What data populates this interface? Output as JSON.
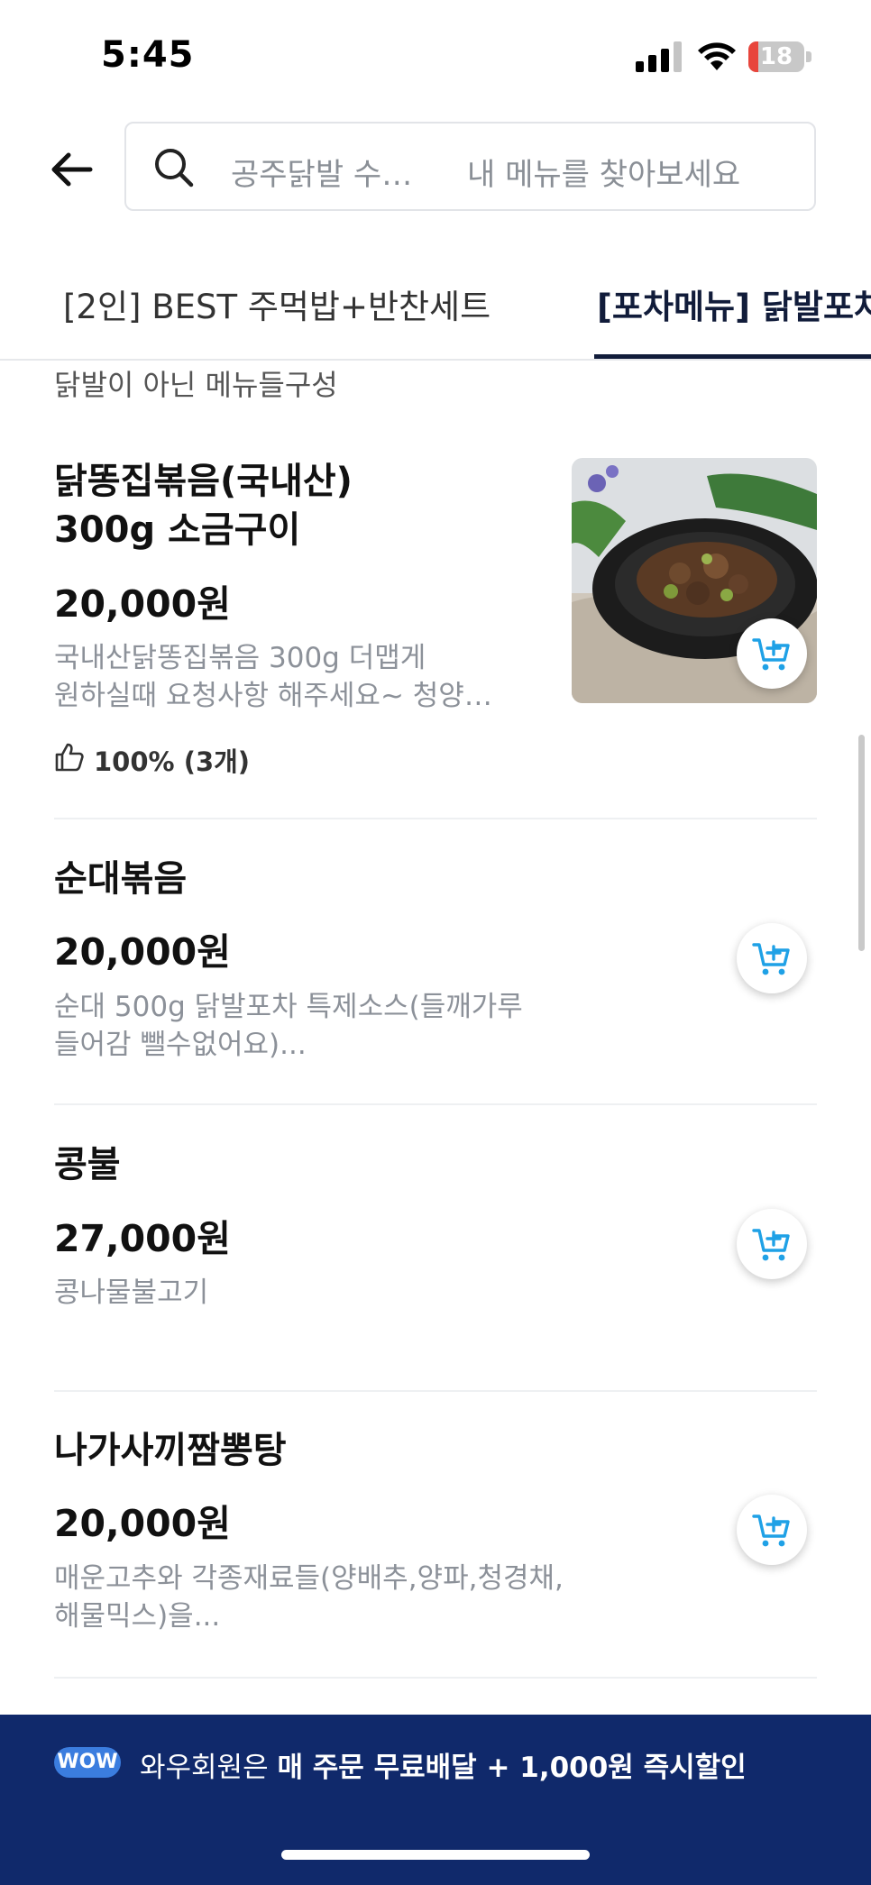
{
  "status_bar": {
    "time": "5:45",
    "battery": "18",
    "battery_fraction": 0.18
  },
  "search": {
    "tag": "공주닭발 수…",
    "placeholder": "내 메뉴를 찾아보세요"
  },
  "tabs": [
    {
      "label": "[2인] BEST 주먹밥+반찬세트",
      "selected": false
    },
    {
      "label": "[포차메뉴] 닭발포차",
      "selected": true
    }
  ],
  "section": {
    "description": "닭발이 아닌 메뉴들구성"
  },
  "items": [
    {
      "name_line1": "닭똥집볶음(국내산)",
      "name_line2": "300g 소금구이",
      "price": "20,000원",
      "desc_line1": "국내산닭똥집볶음 300g 더맵게",
      "desc_line2": "원하실때 요청사항 해주세요~ 청양…",
      "rating": "100% (3개)"
    },
    {
      "name_line1": "순대볶음",
      "price": "20,000원",
      "desc_line1": "순대 500g 닭발포차 특제소스(들깨가루",
      "desc_line2": "들어감 뺄수없어요)..."
    },
    {
      "name_line1": "콩불",
      "price": "27,000원",
      "desc_line1": "콩나물불고기"
    },
    {
      "name_line1": "나가사끼짬뽕탕",
      "price": "20,000원",
      "desc_line1": "매운고추와 각종재료들(양배추,양파,청경채,",
      "desc_line2": "해물믹스)을..."
    }
  ],
  "banner": {
    "badge": "WOW",
    "text": "와우회원은 ",
    "text_bold": "매 주문 무료배달 + 1,000원 즉시할인"
  },
  "colors": {
    "primary_navy": "#10296b",
    "cart_icon": "#1fa1e6",
    "wow_badge": "#3b7ddf",
    "tab_active": "#111c3a"
  }
}
